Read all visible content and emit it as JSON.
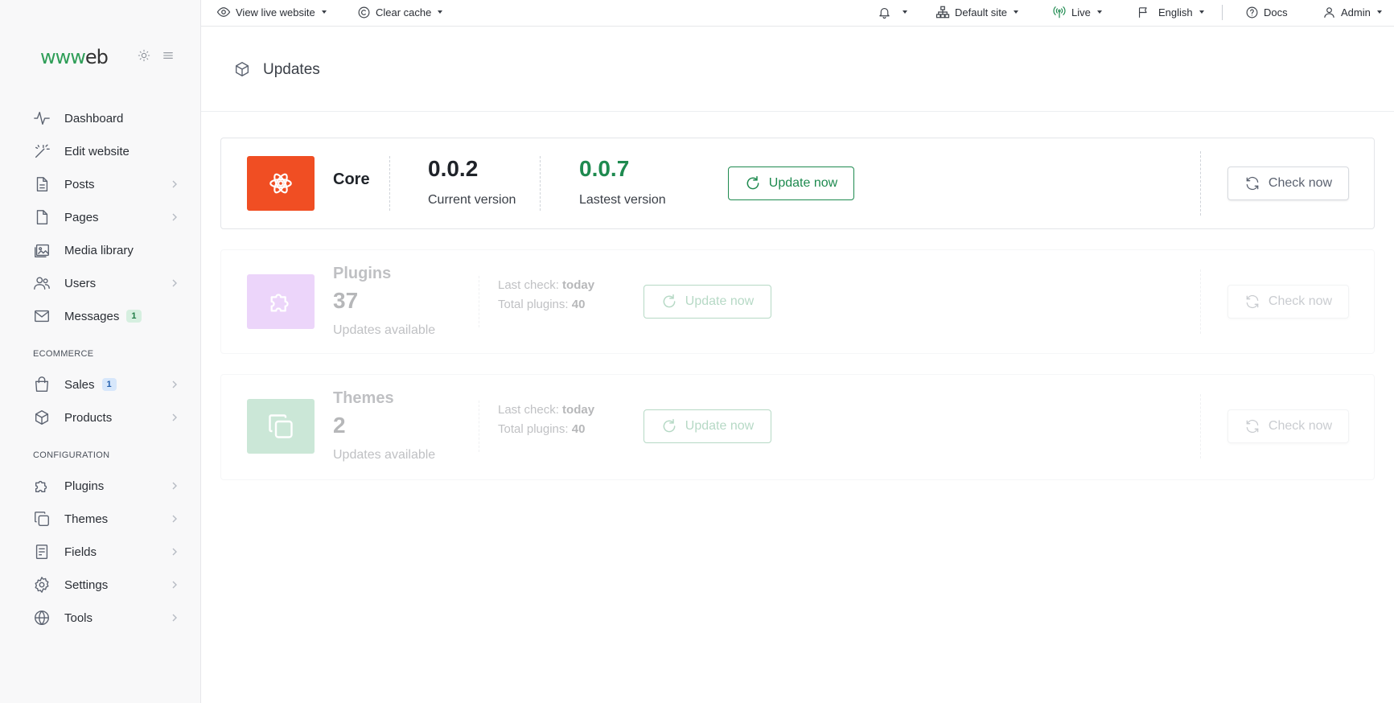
{
  "brand": {
    "logo_text": "www",
    "logo_suffix": "eb"
  },
  "sidebar": {
    "items": [
      {
        "label": "Dashboard",
        "icon": "activity-icon"
      },
      {
        "label": "Edit website",
        "icon": "magic-wand-icon"
      },
      {
        "label": "Posts",
        "icon": "file-text-icon",
        "has_children": true
      },
      {
        "label": "Pages",
        "icon": "file-icon",
        "has_children": true
      },
      {
        "label": "Media library",
        "icon": "image-icon"
      },
      {
        "label": "Users",
        "icon": "users-icon",
        "has_children": true
      },
      {
        "label": "Messages",
        "icon": "mail-icon",
        "badge": "1"
      }
    ],
    "ecommerce_label": "ECOMMERCE",
    "ecommerce_items": [
      {
        "label": "Sales",
        "icon": "shopping-bag-icon",
        "badge": "1",
        "has_children": true
      },
      {
        "label": "Products",
        "icon": "box-icon",
        "has_children": true
      }
    ],
    "configuration_label": "CONFIGURATION",
    "configuration_items": [
      {
        "label": "Plugins",
        "icon": "puzzle-icon",
        "has_children": true
      },
      {
        "label": "Themes",
        "icon": "copy-icon",
        "has_children": true
      },
      {
        "label": "Fields",
        "icon": "form-icon",
        "has_children": true
      },
      {
        "label": "Settings",
        "icon": "gear-icon",
        "has_children": true
      },
      {
        "label": "Tools",
        "icon": "globe-icon",
        "has_children": true
      }
    ]
  },
  "topbar": {
    "view_live": "View live website",
    "clear_cache": "Clear cache",
    "site": "Default site",
    "mode": "Live",
    "language": "English",
    "docs": "Docs",
    "user": "Admin"
  },
  "page": {
    "title": "Updates"
  },
  "core": {
    "name": "Core",
    "current_version": "0.0.2",
    "current_label": "Current version",
    "latest_version": "0.0.7",
    "latest_label": "Lastest version",
    "update_label": "Update now",
    "check_label": "Check now"
  },
  "plugins": {
    "name": "Plugins",
    "count": "37",
    "count_label": "Updates available",
    "last_check_label": "Last check:",
    "last_check_value": "today",
    "total_label": "Total plugins:",
    "total_value": "40",
    "update_label": "Update now",
    "check_label": "Check now"
  },
  "themes": {
    "name": "Themes",
    "count": "2",
    "count_label": "Updates available",
    "last_check_label": "Last check:",
    "last_check_value": "today",
    "total_label": "Total plugins:",
    "total_value": "40",
    "update_label": "Update now",
    "check_label": "Check now"
  },
  "colors": {
    "accent_green": "#1e8a4f",
    "core_logo": "#f04e23",
    "plugins_logo": "#c77ff0",
    "themes_logo": "#5fb886"
  }
}
